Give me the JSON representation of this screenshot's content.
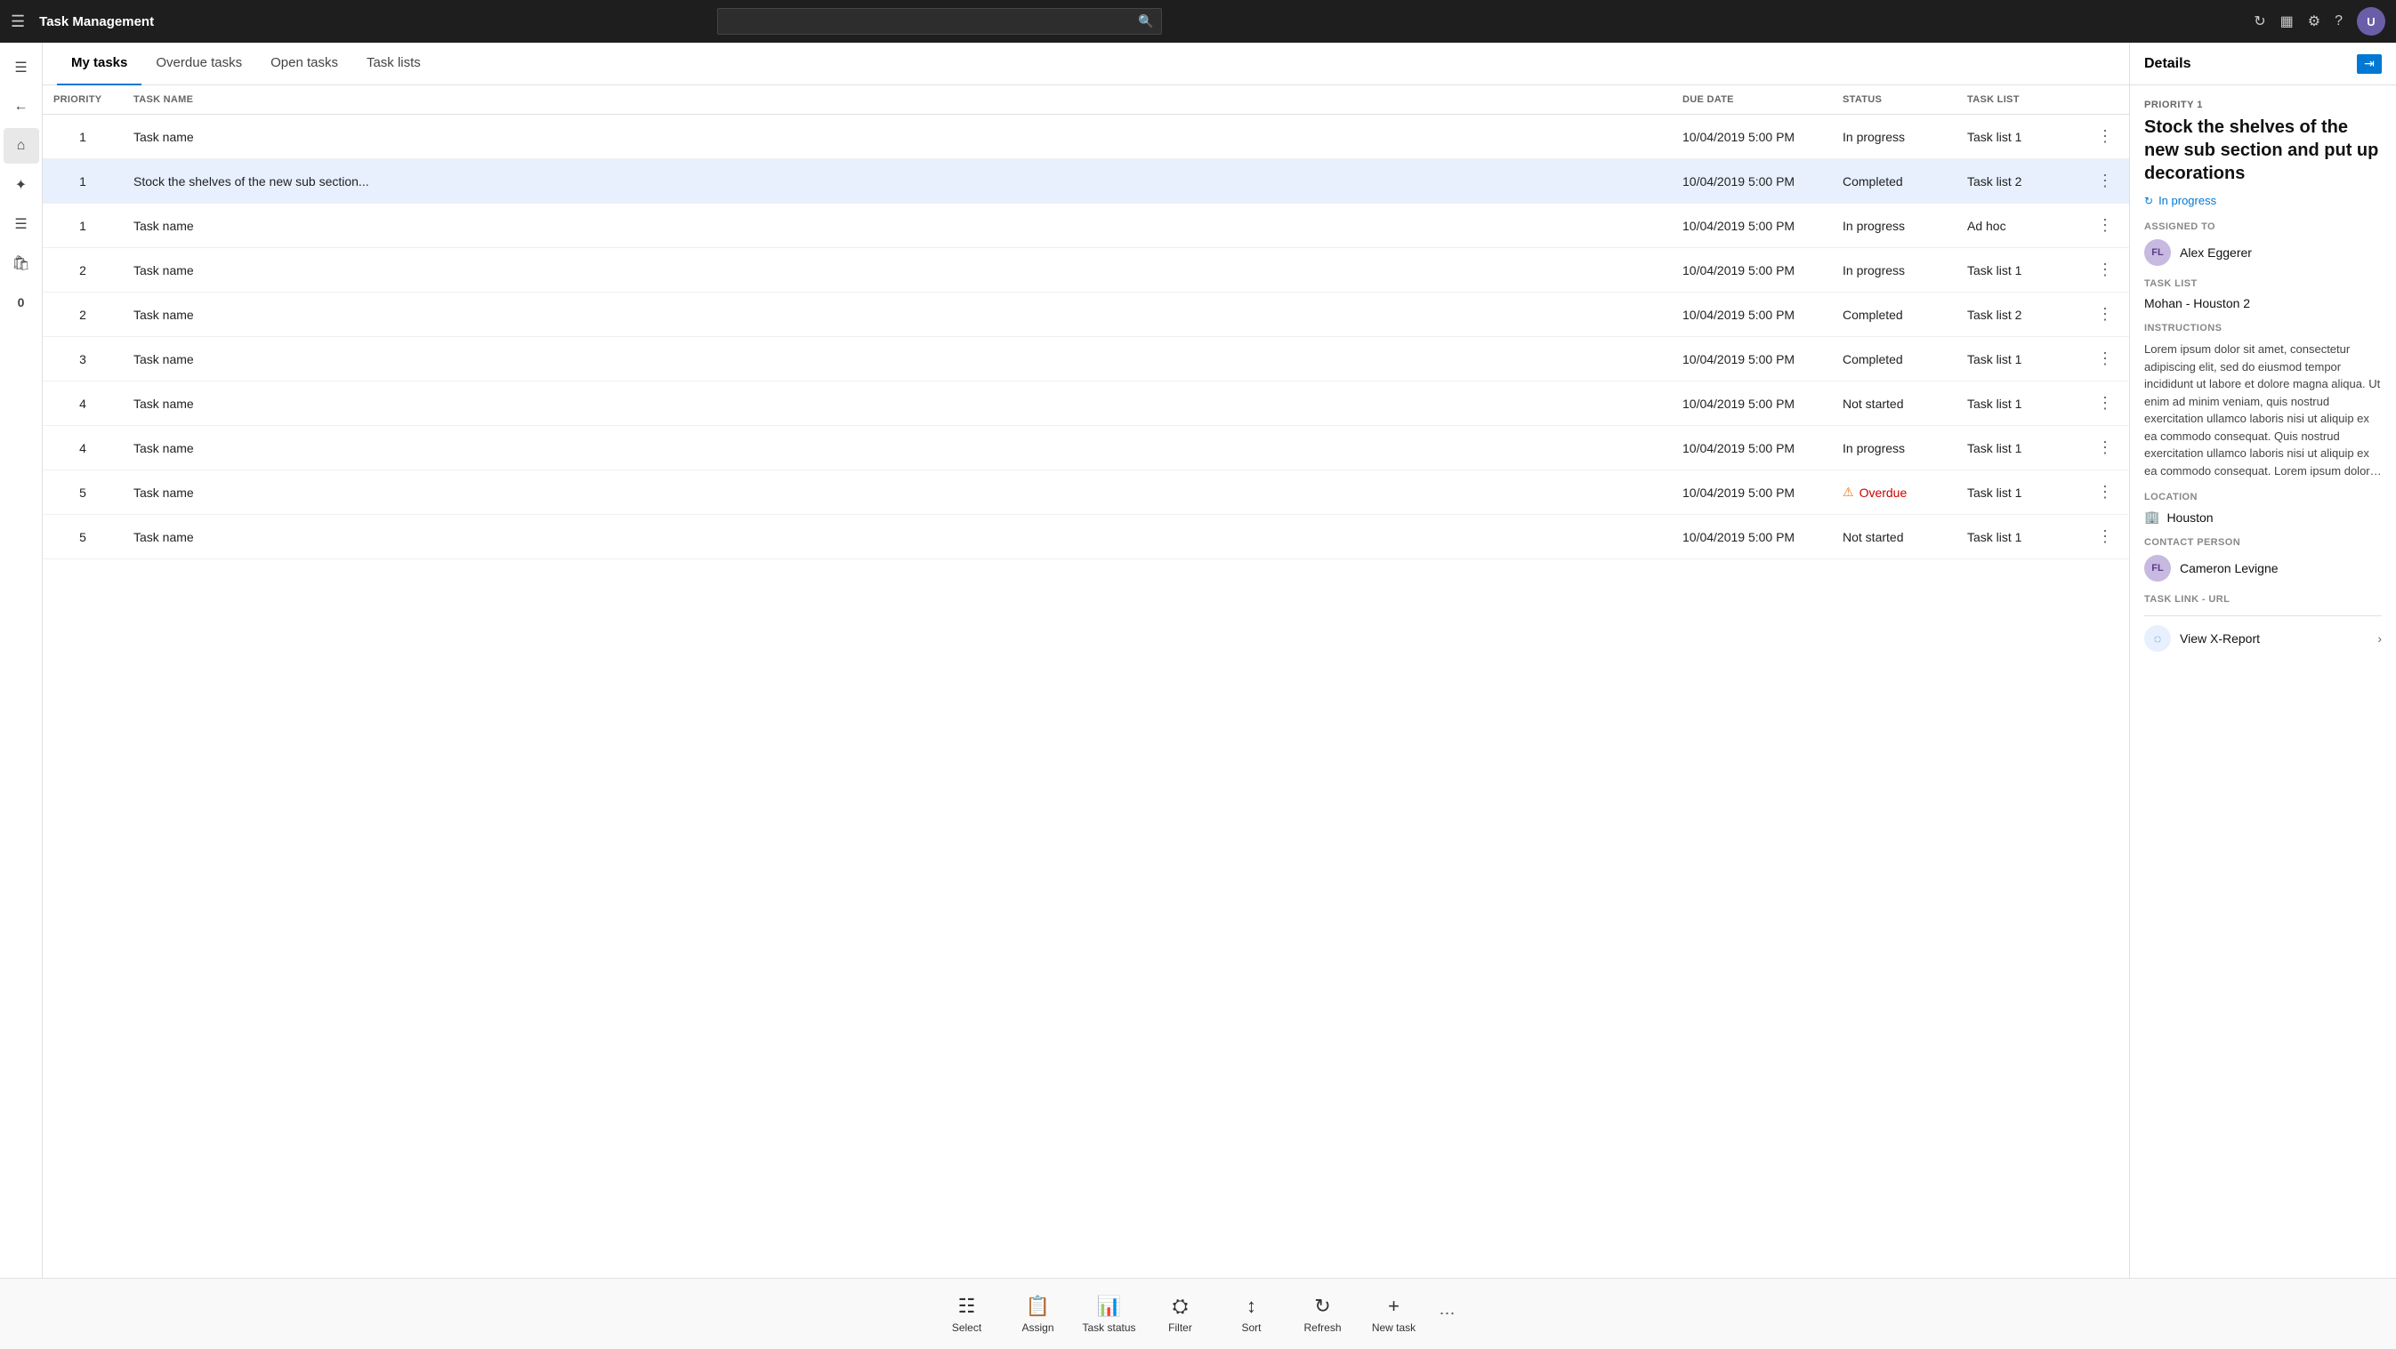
{
  "app": {
    "title": "Task Management"
  },
  "search": {
    "placeholder": ""
  },
  "tabs": [
    {
      "id": "my-tasks",
      "label": "My tasks",
      "active": true
    },
    {
      "id": "overdue-tasks",
      "label": "Overdue tasks",
      "active": false
    },
    {
      "id": "open-tasks",
      "label": "Open tasks",
      "active": false
    },
    {
      "id": "task-lists",
      "label": "Task lists",
      "active": false
    }
  ],
  "table": {
    "columns": [
      {
        "id": "priority",
        "label": "Priority"
      },
      {
        "id": "task-name",
        "label": "Task Name"
      },
      {
        "id": "due-date",
        "label": "Due Date"
      },
      {
        "id": "status",
        "label": "Status"
      },
      {
        "id": "task-list",
        "label": "Task List"
      }
    ],
    "rows": [
      {
        "priority": "1",
        "task_name": "Task name",
        "due_date": "10/04/2019 5:00 PM",
        "status": "In progress",
        "task_list": "Task list 1",
        "status_type": "normal"
      },
      {
        "priority": "1",
        "task_name": "Stock the shelves of the new sub section...",
        "due_date": "10/04/2019 5:00 PM",
        "status": "Completed",
        "task_list": "Task list 2",
        "status_type": "normal",
        "selected": true
      },
      {
        "priority": "1",
        "task_name": "Task name",
        "due_date": "10/04/2019 5:00 PM",
        "status": "In progress",
        "task_list": "Ad hoc",
        "status_type": "normal"
      },
      {
        "priority": "2",
        "task_name": "Task name",
        "due_date": "10/04/2019 5:00 PM",
        "status": "In progress",
        "task_list": "Task list 1",
        "status_type": "normal"
      },
      {
        "priority": "2",
        "task_name": "Task name",
        "due_date": "10/04/2019 5:00 PM",
        "status": "Completed",
        "task_list": "Task list 2",
        "status_type": "normal"
      },
      {
        "priority": "3",
        "task_name": "Task name",
        "due_date": "10/04/2019 5:00 PM",
        "status": "Completed",
        "task_list": "Task list 1",
        "status_type": "normal"
      },
      {
        "priority": "4",
        "task_name": "Task name",
        "due_date": "10/04/2019 5:00 PM",
        "status": "Not started",
        "task_list": "Task list 1",
        "status_type": "normal"
      },
      {
        "priority": "4",
        "task_name": "Task name",
        "due_date": "10/04/2019 5:00 PM",
        "status": "In progress",
        "task_list": "Task list 1",
        "status_type": "normal"
      },
      {
        "priority": "5",
        "task_name": "Task name",
        "due_date": "10/04/2019 5:00 PM",
        "status": "Overdue",
        "task_list": "Task list 1",
        "status_type": "overdue"
      },
      {
        "priority": "5",
        "task_name": "Task name",
        "due_date": "10/04/2019 5:00 PM",
        "status": "Not started",
        "task_list": "Task list 1",
        "status_type": "normal"
      }
    ]
  },
  "details": {
    "header": "Details",
    "priority_label": "PRIORITY 1",
    "task_title": "Stock the shelves of the new sub section and put up decorations",
    "status": "In progress",
    "assigned_to_label": "Assigned to",
    "assignee_initials": "FL",
    "assignee_name": "Alex Eggerer",
    "task_list_label": "Task list",
    "task_list_value": "Mohan - Houston 2",
    "instructions_label": "Instructions",
    "instructions_text": "Lorem ipsum dolor sit amet, consectetur adipiscing elit, sed do eiusmod tempor incididunt ut labore et dolore magna aliqua. Ut enim ad minim veniam, quis nostrud exercitation ullamco laboris nisi ut aliquip ex ea commodo consequat. Quis nostrud exercitation ullamco laboris nisi ut aliquip ex ea commodo consequat. Lorem ipsum dolor sit amet, consectetur Quis nostrud exercitation ullamco laboris nisi ut",
    "location_label": "Location",
    "location_icon": "🏢",
    "location_value": "Houston",
    "contact_person_label": "Contact person",
    "contact_initials": "FL",
    "contact_name": "Cameron Levigne",
    "task_link_label": "Task link - URL",
    "view_xreport_label": "View X-Report"
  },
  "toolbar": {
    "items": [
      {
        "id": "select",
        "label": "Select",
        "icon": "☰"
      },
      {
        "id": "assign",
        "label": "Assign",
        "icon": "📋"
      },
      {
        "id": "task-status",
        "label": "Task status",
        "icon": "📊"
      },
      {
        "id": "filter",
        "label": "Filter",
        "icon": "⚙"
      },
      {
        "id": "sort",
        "label": "Sort",
        "icon": "↕"
      },
      {
        "id": "refresh",
        "label": "Refresh",
        "icon": "↺"
      },
      {
        "id": "new-task",
        "label": "New task",
        "icon": "+"
      }
    ],
    "more_icon": "···"
  },
  "sidebar": {
    "icons": [
      {
        "id": "hamburger",
        "icon": "≡",
        "label": "menu-icon"
      },
      {
        "id": "back",
        "icon": "←",
        "label": "back-icon"
      },
      {
        "id": "home",
        "icon": "⌂",
        "label": "home-icon"
      },
      {
        "id": "tasks",
        "icon": "✦",
        "label": "tasks-icon"
      },
      {
        "id": "list",
        "icon": "☰",
        "label": "list-icon"
      },
      {
        "id": "bag",
        "icon": "🛍",
        "label": "bag-icon"
      },
      {
        "id": "zero",
        "icon": "0",
        "label": "zero-badge-icon"
      }
    ]
  }
}
